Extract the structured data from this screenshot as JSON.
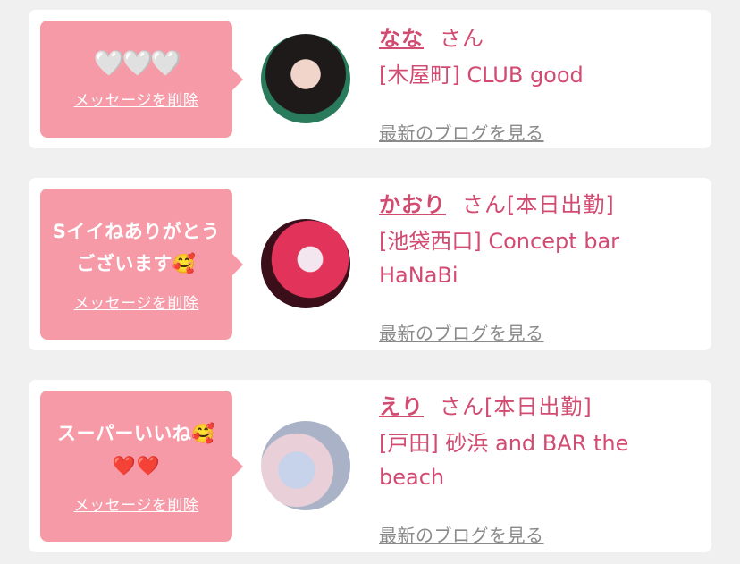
{
  "colors": {
    "page_background": "#f0f0f0",
    "card_background": "#ffffff",
    "bubble_pink": "#f79aa8",
    "name_pink": "#d24b71",
    "link_gray": "#8a8a8a"
  },
  "cards": [
    {
      "message": "🤍🤍🤍",
      "delete_label": "メッセージを削除",
      "name": "なな",
      "suffix": "さん",
      "shop": "[木屋町] CLUB good",
      "blog_link": "最新のブログを見る"
    },
    {
      "message": "Sイイねありがとうございます🥰",
      "delete_label": "メッセージを削除",
      "name": "かおり",
      "suffix": "さん[本日出勤]",
      "shop": "[池袋西口] Concept bar HaNaBi",
      "blog_link": "最新のブログを見る"
    },
    {
      "message": "スーパーいいね🥰❤️❤️",
      "delete_label": "メッセージを削除",
      "name": "えり",
      "suffix": "さん[本日出勤]",
      "shop": "[戸田] 砂浜 and BAR the beach",
      "blog_link": "最新のブログを見る"
    }
  ]
}
